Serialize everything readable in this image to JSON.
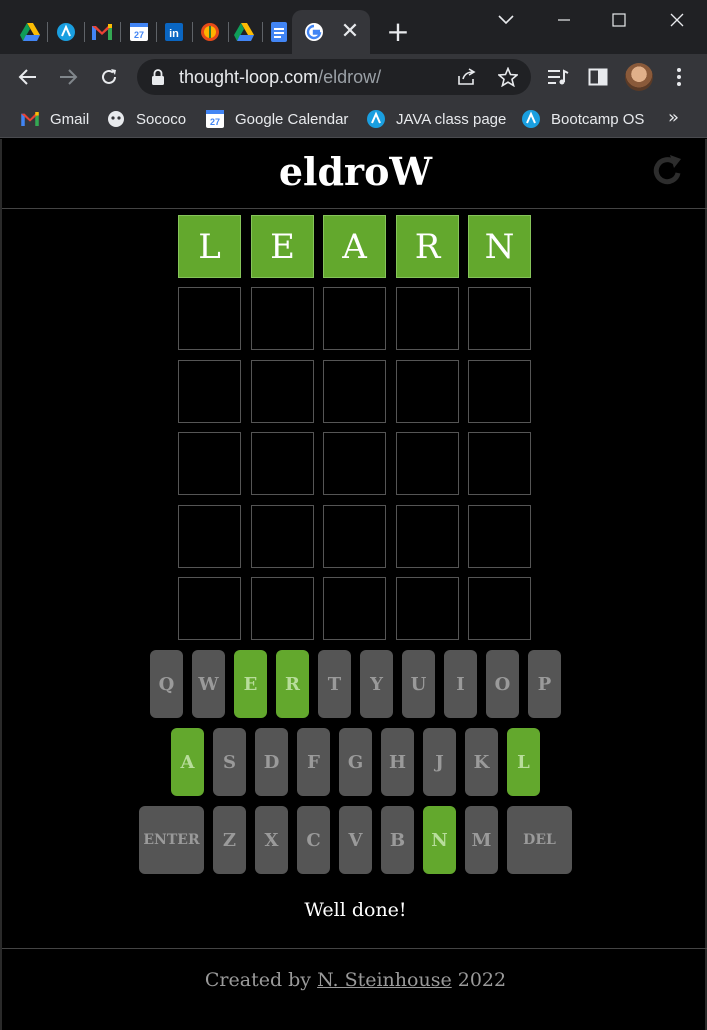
{
  "browser": {
    "tabs": [
      {
        "icon": "google-drive-icon"
      },
      {
        "icon": "atlassian-icon"
      },
      {
        "icon": "gmail-icon"
      },
      {
        "icon": "google-calendar-icon"
      },
      {
        "icon": "linkedin-icon"
      },
      {
        "icon": "app-icon"
      },
      {
        "icon": "google-drive-icon"
      },
      {
        "icon": "google-docs-icon"
      },
      {
        "icon": "google-icon",
        "active": true
      }
    ],
    "tab_close": "✕",
    "new_tab": "+",
    "url_domain": "thought-loop.com",
    "url_path": "/eldrow/",
    "bookmarks": [
      {
        "label": "Gmail",
        "icon": "gmail-icon"
      },
      {
        "label": "Sococo",
        "icon": "sococo-icon"
      },
      {
        "label": "Google Calendar",
        "icon": "google-calendar-icon",
        "badge": "27"
      },
      {
        "label": "JAVA class page",
        "icon": "atlassian-icon"
      },
      {
        "label": "Bootcamp OS",
        "icon": "atlassian-icon"
      }
    ],
    "bookmarks_more": "»",
    "calendar_badge": "27"
  },
  "game": {
    "title": "eldroW",
    "rows": [
      {
        "letters": [
          "L",
          "E",
          "A",
          "R",
          "N"
        ],
        "states": [
          "correct",
          "correct",
          "correct",
          "correct",
          "correct"
        ]
      },
      {
        "letters": [
          "",
          "",
          "",
          "",
          ""
        ],
        "states": [
          "empty",
          "empty",
          "empty",
          "empty",
          "empty"
        ]
      },
      {
        "letters": [
          "",
          "",
          "",
          "",
          ""
        ],
        "states": [
          "empty",
          "empty",
          "empty",
          "empty",
          "empty"
        ]
      },
      {
        "letters": [
          "",
          "",
          "",
          "",
          ""
        ],
        "states": [
          "empty",
          "empty",
          "empty",
          "empty",
          "empty"
        ]
      },
      {
        "letters": [
          "",
          "",
          "",
          "",
          ""
        ],
        "states": [
          "empty",
          "empty",
          "empty",
          "empty",
          "empty"
        ]
      },
      {
        "letters": [
          "",
          "",
          "",
          "",
          ""
        ],
        "states": [
          "empty",
          "empty",
          "empty",
          "empty",
          "empty"
        ]
      }
    ],
    "keyboard": [
      [
        {
          "label": "Q"
        },
        {
          "label": "W"
        },
        {
          "label": "E",
          "state": "correct"
        },
        {
          "label": "R",
          "state": "correct"
        },
        {
          "label": "T"
        },
        {
          "label": "Y"
        },
        {
          "label": "U"
        },
        {
          "label": "I"
        },
        {
          "label": "O"
        },
        {
          "label": "P"
        }
      ],
      [
        {
          "label": "A",
          "state": "correct"
        },
        {
          "label": "S"
        },
        {
          "label": "D"
        },
        {
          "label": "F"
        },
        {
          "label": "G"
        },
        {
          "label": "H"
        },
        {
          "label": "J"
        },
        {
          "label": "K"
        },
        {
          "label": "L",
          "state": "correct"
        }
      ],
      [
        {
          "label": "ENTER",
          "wide": true
        },
        {
          "label": "Z"
        },
        {
          "label": "X"
        },
        {
          "label": "C"
        },
        {
          "label": "V"
        },
        {
          "label": "B"
        },
        {
          "label": "N",
          "state": "correct"
        },
        {
          "label": "M"
        },
        {
          "label": "DEL",
          "wide": true
        }
      ]
    ],
    "message": "Well done!",
    "footer_prefix": "Created by",
    "footer_author": "N. Steinhouse",
    "footer_year": "2022"
  },
  "colors": {
    "correct": "#63a82d",
    "key_default": "#555555",
    "background": "#000000"
  }
}
